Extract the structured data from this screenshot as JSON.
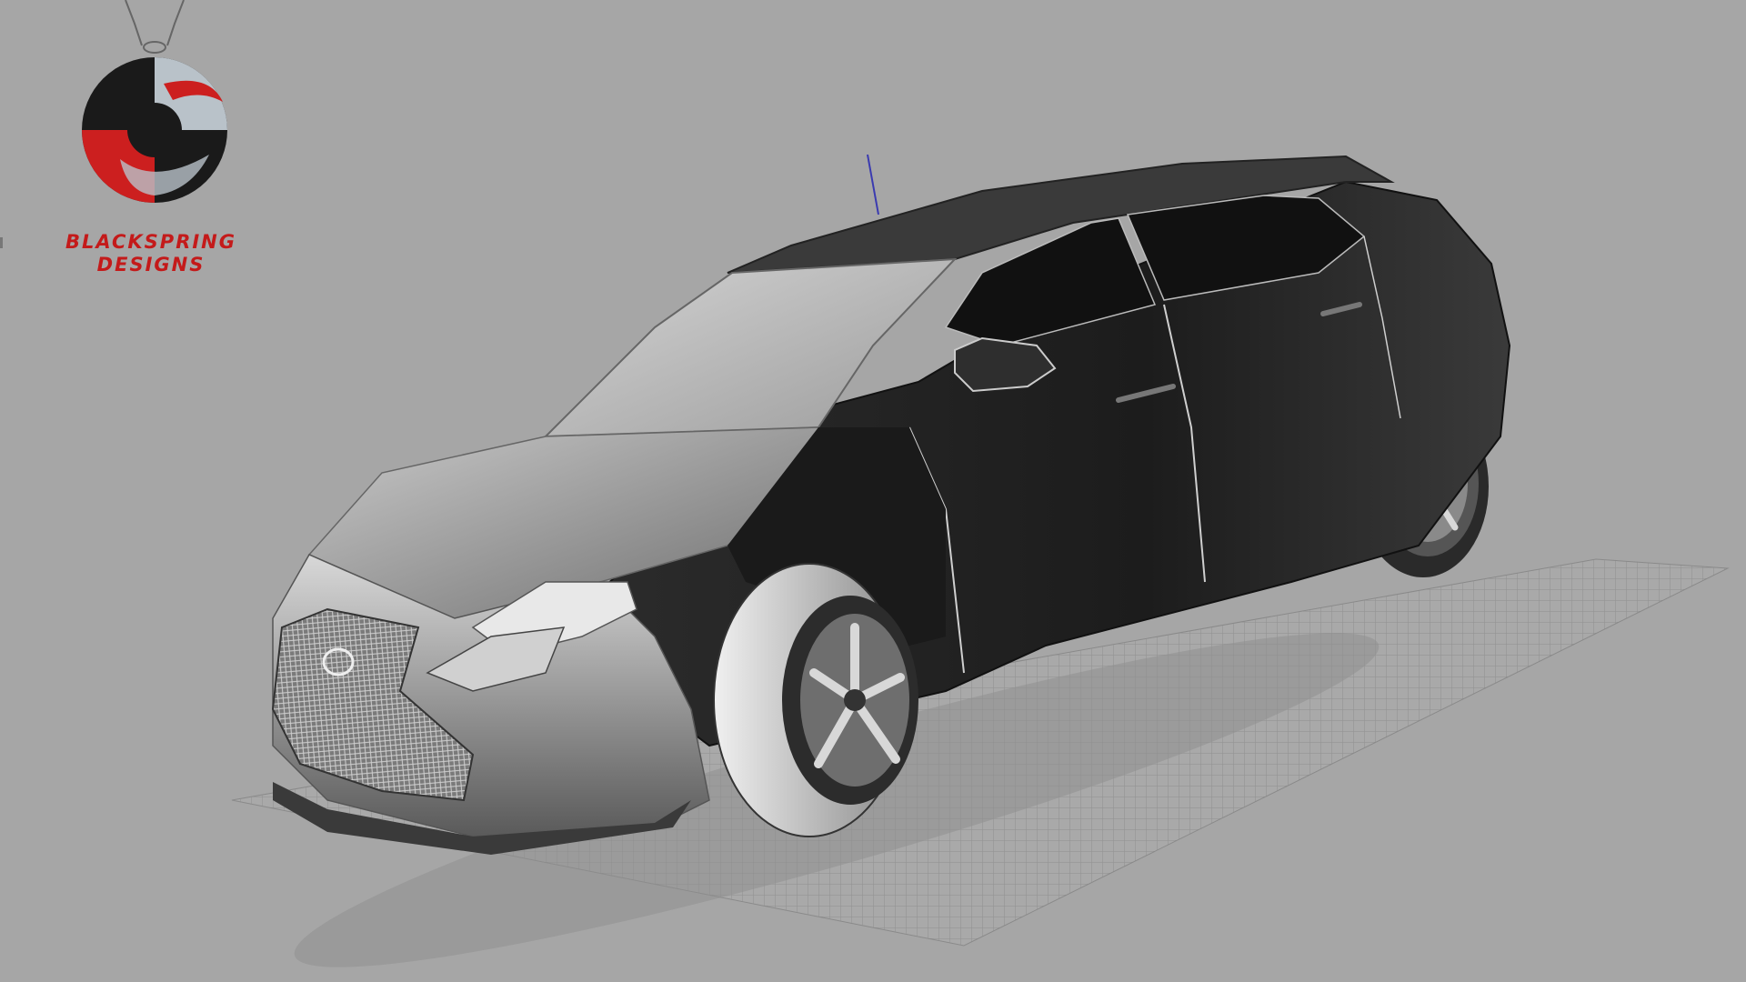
{
  "brand": {
    "line1": "BLACKSPRING",
    "line2": "DESIGNS",
    "logo_icon": "s-swirl-pendant-logo",
    "accent_color": "#c41a1a"
  },
  "viewport": {
    "background_color": "#a6a6a6",
    "model": "black-suv-3d-model",
    "ground": "construction-grid-plane",
    "axis_icon": "z-axis-indicator"
  }
}
